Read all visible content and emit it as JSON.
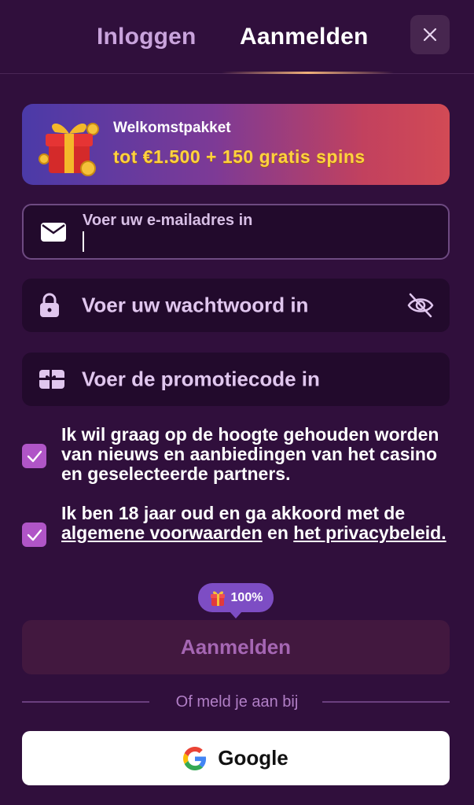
{
  "tabs": {
    "login": "Inloggen",
    "register": "Aanmelden"
  },
  "banner": {
    "title": "Welkomstpakket",
    "offer": "tot €1.500 + 150 gratis spins"
  },
  "email": {
    "label": "Voer uw e-mailadres in",
    "value": ""
  },
  "password": {
    "placeholder": "Voer uw wachtwoord in"
  },
  "promo": {
    "placeholder": "Voer de promotiecode in"
  },
  "consents": {
    "news": "Ik wil graag op de hoogte gehouden worden van nieuws en aanbiedingen van het casino en geselecteerde partners.",
    "terms_prefix": "Ik ben 18 jaar oud en ga akkoord met de",
    "terms_link": "algemene voorwaarden",
    "terms_and": "en",
    "privacy_link": "het privacybeleid."
  },
  "bonus": {
    "percent": "100%"
  },
  "submit": {
    "label": "Aanmelden"
  },
  "divider": {
    "text": "Of meld je aan bij"
  },
  "google": {
    "label": "Google"
  },
  "colors": {
    "background": "#300f3c",
    "checkbox": "#b055c7",
    "offer_text": "#ffd23f",
    "bonus_pill": "#7d4dc4"
  },
  "icons": [
    "close-icon",
    "gift-icon",
    "mail-icon",
    "lock-icon",
    "eye-off-icon",
    "ticket-icon",
    "check-icon",
    "google-icon"
  ]
}
